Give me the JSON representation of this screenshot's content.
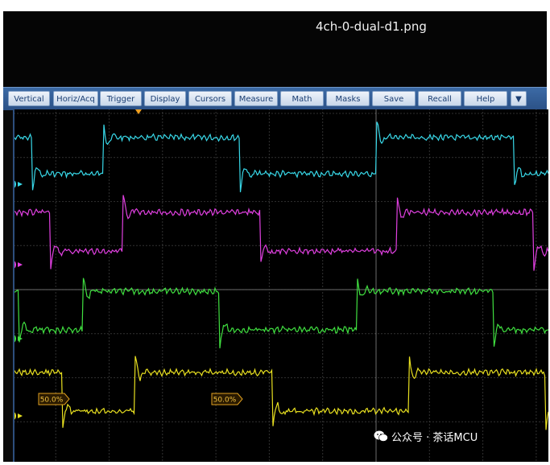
{
  "window": {
    "filename": "4ch-0-dual-d1.png"
  },
  "menu": {
    "items": [
      "Vertical",
      "Horiz/Acq",
      "Trigger",
      "Display",
      "Cursors",
      "Measure",
      "Math",
      "Masks",
      "Save",
      "Recall",
      "Help"
    ],
    "dropdown_icon": "dropdown-triangle-icon"
  },
  "channels": [
    {
      "label": "2",
      "color": "#38d8e8"
    },
    {
      "label": "3",
      "color": "#e040e0"
    },
    {
      "label": "4",
      "color": "#40e040"
    },
    {
      "label": "1",
      "color": "#e8e020"
    }
  ],
  "markers": {
    "duty_labels": [
      "50.0%",
      "50.0%"
    ],
    "trigger_icon": "trigger-position-icon"
  },
  "watermark": {
    "text": "公众号 · 茶话MCU",
    "icon": "wechat-icon"
  }
}
